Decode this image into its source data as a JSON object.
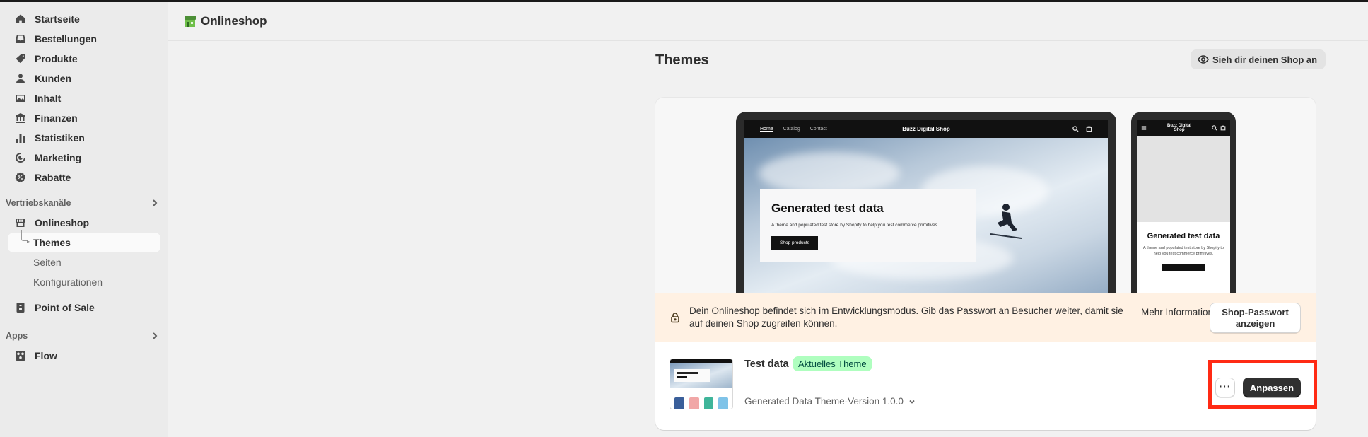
{
  "sidebar": {
    "items": [
      {
        "label": "Startseite",
        "icon": "home-icon"
      },
      {
        "label": "Bestellungen",
        "icon": "inbox-icon"
      },
      {
        "label": "Produkte",
        "icon": "tag-icon"
      },
      {
        "label": "Kunden",
        "icon": "person-icon"
      },
      {
        "label": "Inhalt",
        "icon": "image-icon"
      },
      {
        "label": "Finanzen",
        "icon": "bank-icon"
      },
      {
        "label": "Statistiken",
        "icon": "bar-chart-icon"
      },
      {
        "label": "Marketing",
        "icon": "target-icon"
      },
      {
        "label": "Rabatte",
        "icon": "discount-icon"
      }
    ],
    "sales_channels": {
      "heading": "Vertriebskanäle",
      "onlineshop": "Onlineshop",
      "sub_items": [
        "Themes",
        "Seiten",
        "Konfigurationen"
      ],
      "point_of_sale": "Point of Sale"
    },
    "apps": {
      "heading": "Apps",
      "flow": "Flow"
    }
  },
  "header": {
    "title": "Onlineshop"
  },
  "page": {
    "title": "Themes",
    "view_shop_button": "Sieh dir deinen Shop an"
  },
  "preview": {
    "desktop": {
      "nav_links": [
        "Home",
        "Catalog",
        "Contact"
      ],
      "brand": "Buzz Digital Shop",
      "hero_title": "Generated test data",
      "hero_text": "A theme and populated test store by Shopify to help you test commerce primitives.",
      "hero_button": "Shop products"
    },
    "mobile": {
      "brand": "Buzz Digital Shop",
      "hero_title": "Generated test data",
      "hero_text": "A theme and populated test store by Shopify to help you test commerce primitives."
    }
  },
  "banner": {
    "message": "Dein Onlineshop befindet sich im Entwicklungsmodus. Gib das Passwort an Besucher weiter, damit sie auf deinen Shop zugreifen können.",
    "more_info": "Mehr Informationen",
    "password_button": "Shop-Passwort anzeigen"
  },
  "theme": {
    "name": "Test data",
    "badge": "Aktuelles Theme",
    "version": "Generated Data Theme-Version 1.0.0",
    "customize_button": "Anpassen",
    "more_actions": "···"
  },
  "colors": {
    "accent_highlight": "#ff2a14",
    "badge_bg": "#affebf",
    "banner_bg": "#fff1e3",
    "primary_button": "#303030"
  }
}
